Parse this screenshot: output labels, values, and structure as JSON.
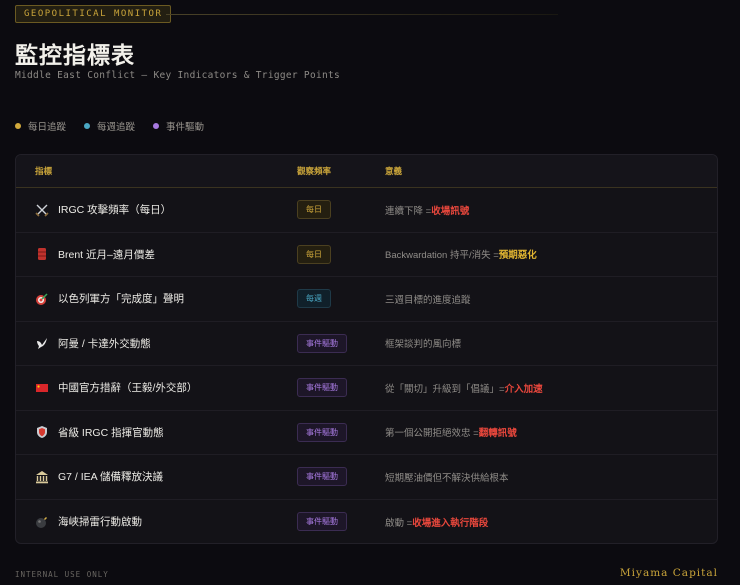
{
  "header": {
    "tag": "GEOPOLITICAL MONITOR",
    "title": "監控指標表",
    "subtitle": "Middle East Conflict — Key Indicators & Trigger Points"
  },
  "legend": [
    {
      "label": "每日追蹤",
      "color": "#d2aa3c"
    },
    {
      "label": "每週追蹤",
      "color": "#4aa8c4"
    },
    {
      "label": "事件驅動",
      "color": "#a779e0"
    }
  ],
  "table": {
    "columns": [
      "指標",
      "觀察頻率",
      "意義"
    ],
    "rows": [
      {
        "icon": "crossed-swords-icon",
        "name": "IRGC 攻擊頻率（每日）",
        "freq": "每日",
        "type": "daily",
        "meaning": "連續下降 =",
        "highlight": "收場訊號",
        "hl_color": "#e8473c"
      },
      {
        "icon": "oil-drum-icon",
        "name": "Brent 近月–遠月價差",
        "freq": "每日",
        "type": "daily",
        "meaning": "Backwardation 持平/消失 =",
        "highlight": "預期惡化",
        "hl_color": "#e0b431"
      },
      {
        "icon": "target-icon",
        "name": "以色列軍方「完成度」聲明",
        "freq": "每週",
        "type": "weekly",
        "meaning": "三週目標的進度追蹤",
        "highlight": "",
        "hl_color": ""
      },
      {
        "icon": "dove-icon",
        "name": "阿曼 / 卡達外交動態",
        "freq": "事件驅動",
        "type": "event",
        "meaning": "框架談判的風向標",
        "highlight": "",
        "hl_color": ""
      },
      {
        "icon": "china-flag-icon",
        "name": "中國官方措辭（王毅/外交部）",
        "freq": "事件驅動",
        "type": "event",
        "meaning": "從「關切」升級到「倡議」=",
        "highlight": "介入加速",
        "hl_color": "#e8473c"
      },
      {
        "icon": "shield-icon",
        "name": "省級 IRGC 指揮官動態",
        "freq": "事件驅動",
        "type": "event",
        "meaning": "第一個公開拒絕效忠 =",
        "highlight": "翻轉訊號",
        "hl_color": "#e8473c"
      },
      {
        "icon": "classical-building-icon",
        "name": "G7 / IEA 儲備釋放決議",
        "freq": "事件驅動",
        "type": "event",
        "meaning": "短期壓油價但不解決供給根本",
        "highlight": "",
        "hl_color": ""
      },
      {
        "icon": "bomb-icon",
        "name": "海峽掃雷行動啟動",
        "freq": "事件驅動",
        "type": "event",
        "meaning": "啟動 =",
        "highlight": "收場進入執行階段",
        "hl_color": "#e8473c"
      }
    ]
  },
  "footer": {
    "note": "INTERNAL USE ONLY",
    "brand": "Miyama Capital"
  }
}
